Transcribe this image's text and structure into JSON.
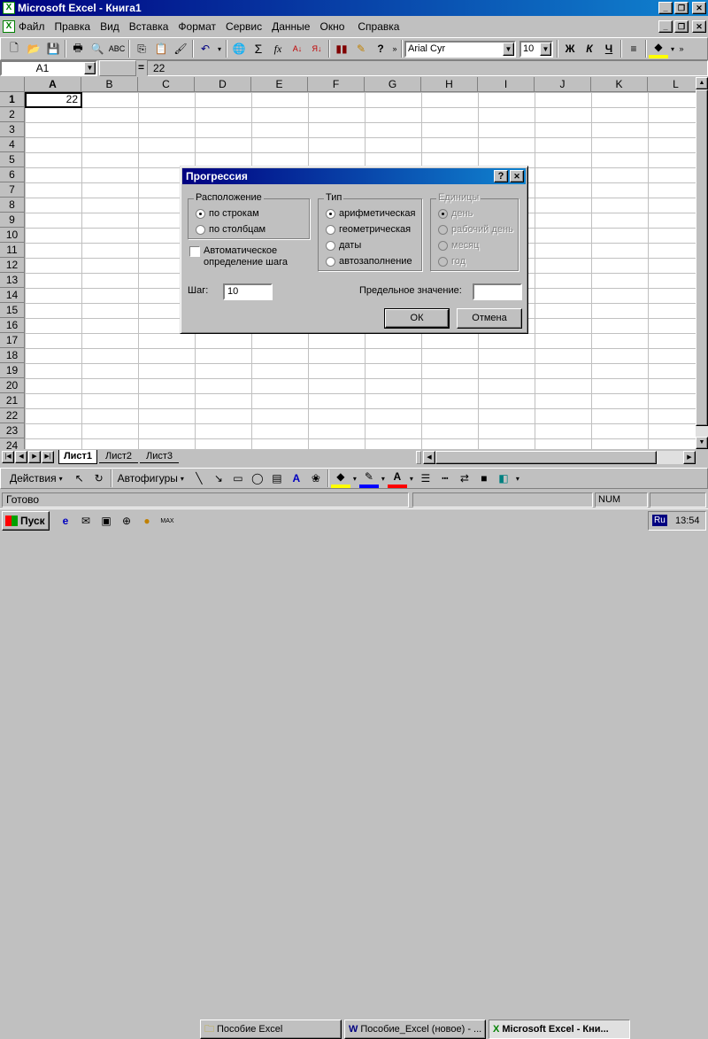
{
  "window": {
    "title": "Microsoft Excel - Книга1"
  },
  "menu": [
    "Файл",
    "Правка",
    "Вид",
    "Вставка",
    "Формат",
    "Сервис",
    "Данные",
    "Окно",
    "Справка"
  ],
  "toolbar": {
    "font_name": "Arial Cyr",
    "font_size": "10",
    "bold": "Ж",
    "italic": "К",
    "underline": "Ч"
  },
  "formula_bar": {
    "cell_ref": "A1",
    "equals": "=",
    "value": "22"
  },
  "columns": [
    "A",
    "B",
    "C",
    "D",
    "E",
    "F",
    "G",
    "H",
    "I",
    "J",
    "K",
    "L"
  ],
  "rows": [
    "1",
    "2",
    "3",
    "4",
    "5",
    "6",
    "7",
    "8",
    "9",
    "10",
    "11",
    "12",
    "13",
    "14",
    "15",
    "16",
    "17",
    "18",
    "19",
    "20",
    "21",
    "22",
    "23",
    "24"
  ],
  "cell_a1": "22",
  "dialog": {
    "title": "Прогрессия",
    "help": "?",
    "close": "✕",
    "location_group": "Расположение",
    "by_rows": "по строкам",
    "by_columns": "по столбцам",
    "type_group": "Тип",
    "arithmetic": "арифметическая",
    "geometric": "геометрическая",
    "dates": "даты",
    "autofill": "автозаполнение",
    "units_group": "Единицы",
    "day": "день",
    "workday": "рабочий день",
    "month": "месяц",
    "year": "год",
    "auto_step_line1": "Автоматическое",
    "auto_step_line2": "определение шага",
    "step_label": "Шаг:",
    "step_value": "10",
    "limit_label": "Предельное значение:",
    "limit_value": "",
    "ok": "ОК",
    "cancel": "Отмена"
  },
  "sheets": [
    "Лист1",
    "Лист2",
    "Лист3"
  ],
  "drawing": {
    "actions": "Действия",
    "autoshapes": "Автофигуры"
  },
  "status": {
    "ready": "Готово",
    "num": "NUM"
  },
  "taskbar": {
    "start": "Пуск",
    "tasks": [
      "Пособие Excel",
      "Пособие_Excel (новое) - ...",
      "Microsoft Excel - Кни..."
    ],
    "lang": "Ru",
    "clock": "13:54"
  }
}
